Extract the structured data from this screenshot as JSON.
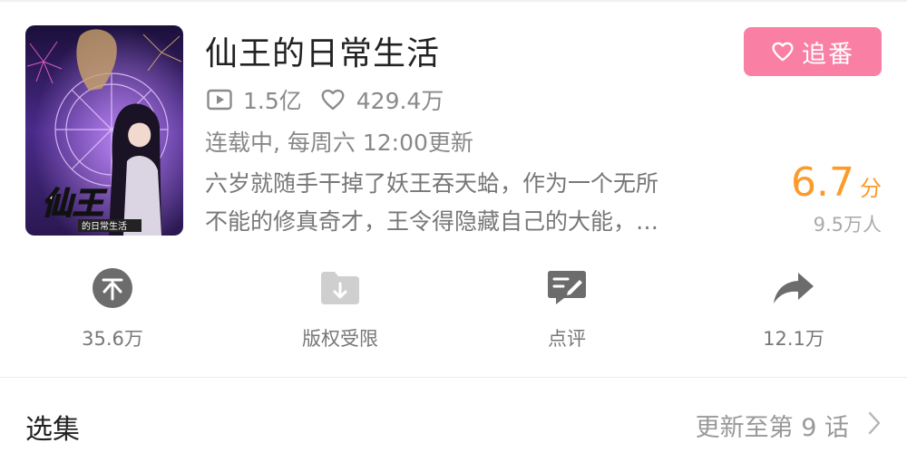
{
  "title": "仙王的日常生活",
  "cover": {
    "logo_text": "仙王",
    "sub_text": "的日常生活"
  },
  "stats": {
    "plays": "1.5亿",
    "likes": "429.4万"
  },
  "status": "连载中, 每周六 12:00更新",
  "description": {
    "line1": "六岁就随手干掉了妖王吞天蛤，作为一个无所",
    "line2": "不能的修真奇才，王令得隐藏自己的大能，…"
  },
  "follow_button": {
    "label": "追番",
    "icon": "heart-icon",
    "color": "#f97fa5"
  },
  "rating": {
    "score": "6.7",
    "unit": "分",
    "raters": "9.5万人",
    "color": "#fd9a29"
  },
  "actions": [
    {
      "label": "35.6万",
      "icon": "coin-icon"
    },
    {
      "label": "版权受限",
      "icon": "download-folder-icon"
    },
    {
      "label": "点评",
      "icon": "review-icon"
    },
    {
      "label": "12.1万",
      "icon": "share-icon"
    }
  ],
  "episodes": {
    "label": "选集",
    "update": "更新至第 9 话"
  }
}
